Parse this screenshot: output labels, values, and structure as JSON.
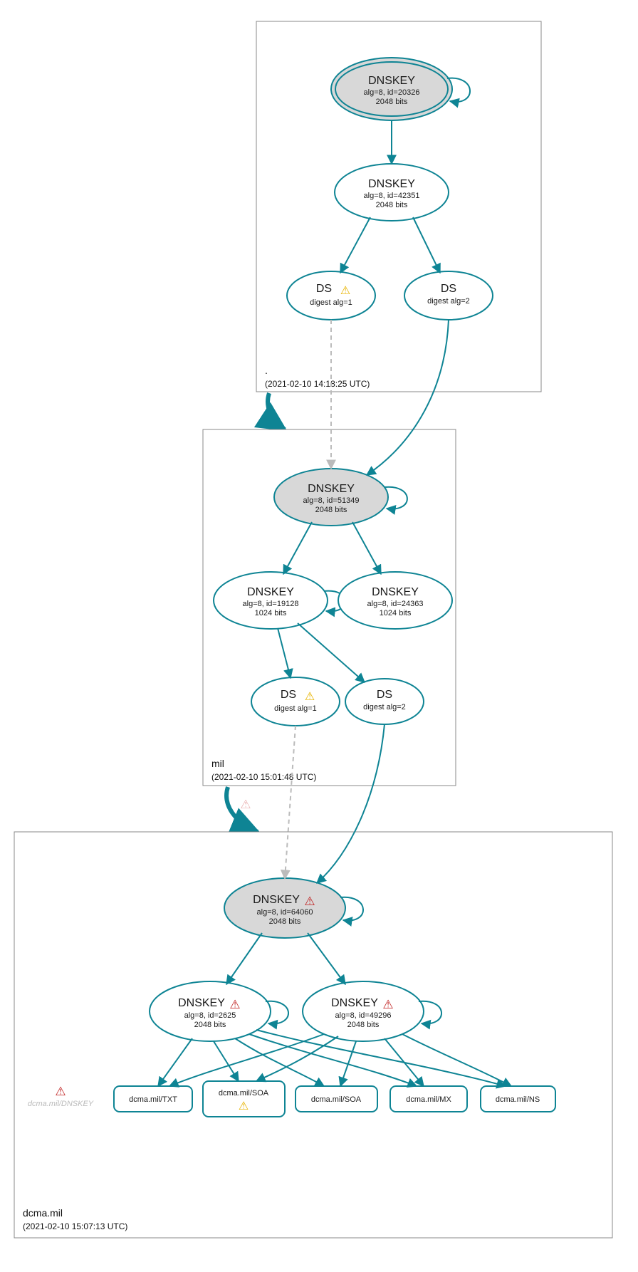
{
  "colors": {
    "teal": "#0e8494",
    "grey_fill": "#d8d8d8"
  },
  "zones": {
    "root": {
      "label": ".",
      "timestamp": "(2021-02-10 14:18:25 UTC)"
    },
    "mil": {
      "label": "mil",
      "timestamp": "(2021-02-10 15:01:48 UTC)"
    },
    "dcma": {
      "label": "dcma.mil",
      "timestamp": "(2021-02-10 15:07:13 UTC)"
    }
  },
  "nodes": {
    "root_ksk": {
      "title": "DNSKEY",
      "line1": "alg=8, id=20326",
      "line2": "2048 bits"
    },
    "root_zsk": {
      "title": "DNSKEY",
      "line1": "alg=8, id=42351",
      "line2": "2048 bits"
    },
    "root_ds1": {
      "title": "DS",
      "line1": "digest alg=1",
      "warn": "yellow"
    },
    "root_ds2": {
      "title": "DS",
      "line1": "digest alg=2"
    },
    "mil_ksk": {
      "title": "DNSKEY",
      "line1": "alg=8, id=51349",
      "line2": "2048 bits"
    },
    "mil_zsk1": {
      "title": "DNSKEY",
      "line1": "alg=8, id=19128",
      "line2": "1024 bits"
    },
    "mil_zsk2": {
      "title": "DNSKEY",
      "line1": "alg=8, id=24363",
      "line2": "1024 bits"
    },
    "mil_ds1": {
      "title": "DS",
      "line1": "digest alg=1",
      "warn": "yellow"
    },
    "mil_ds2": {
      "title": "DS",
      "line1": "digest alg=2"
    },
    "dcma_ksk": {
      "title": "DNSKEY",
      "line1": "alg=8, id=64060",
      "line2": "2048 bits",
      "warn": "red"
    },
    "dcma_zsk1": {
      "title": "DNSKEY",
      "line1": "alg=8, id=2625",
      "line2": "2048 bits",
      "warn": "red"
    },
    "dcma_zsk2": {
      "title": "DNSKEY",
      "line1": "alg=8, id=49296",
      "line2": "2048 bits",
      "warn": "red"
    },
    "ghost": {
      "label": "dcma.mil/DNSKEY",
      "warn": "red"
    }
  },
  "rrs": {
    "txt": "dcma.mil/TXT",
    "soa_warn": "dcma.mil/SOA",
    "soa": "dcma.mil/SOA",
    "mx": "dcma.mil/MX",
    "ns": "dcma.mil/NS"
  },
  "icons": {
    "warn_yellow": "⚠",
    "warn_red": "⚠"
  }
}
